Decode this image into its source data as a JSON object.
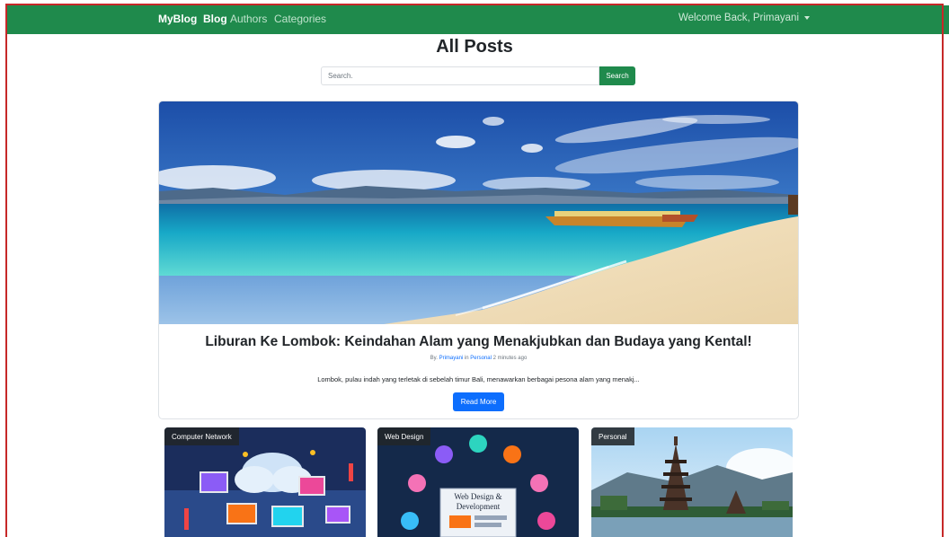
{
  "navbar": {
    "brand": "MyBlog",
    "links": [
      "Blog",
      "Authors",
      "Categories"
    ],
    "active": "Blog",
    "user_menu": "Welcome Back, Primayani",
    "color": "#1f8a4c"
  },
  "page": {
    "title": "All Posts"
  },
  "search": {
    "placeholder": "Search.",
    "button_label": "Search"
  },
  "featured_post": {
    "title": "Liburan Ke Lombok: Keindahan Alam yang Menakjubkan dan Budaya yang Kental!",
    "meta_prefix": "By.",
    "author": "Primayani",
    "meta_in": "in",
    "category": "Personal",
    "time": "2 minutes ago",
    "excerpt": "Lombok, pulau indah yang terletak di sebelah timur Bali, menawarkan berbagai pesona alam yang menakj...",
    "button_label": "Read More"
  },
  "posts": [
    {
      "category": "Computer Network"
    },
    {
      "category": "Web Design",
      "image_text": [
        "Web Design &",
        "Development"
      ]
    },
    {
      "category": "Personal"
    }
  ],
  "colors": {
    "primary": "#0d6efd",
    "success": "#1f8a4c"
  }
}
